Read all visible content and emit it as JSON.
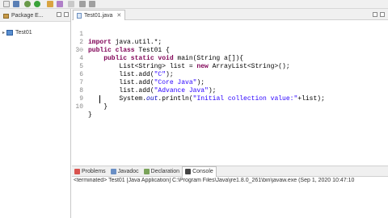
{
  "toolbar": {
    "icons": [
      "new-icon",
      "save-icon",
      "debug-icon",
      "run-icon",
      "search-icon",
      "refactor-icon",
      "navigate-icon",
      "back-icon",
      "forward-icon"
    ]
  },
  "package_explorer": {
    "tab_label": "Package E...",
    "tree": [
      {
        "label": "Test01"
      }
    ]
  },
  "editor": {
    "tab_label": "Test01.java",
    "lines": [
      {
        "num": "1",
        "code": "import java.util.*;"
      },
      {
        "num": "2",
        "code": "public class Test01 {"
      },
      {
        "num": "3⊖",
        "code": "    public static void main(String a[]){"
      },
      {
        "num": "4",
        "code": "        List<String> list = new ArrayList<String>();"
      },
      {
        "num": "5",
        "code": "        list.add(\"C\");"
      },
      {
        "num": "6",
        "code": "        list.add(\"Core Java\");"
      },
      {
        "num": "7",
        "code": "        list.add(\"Advance Java\");"
      },
      {
        "num": "8",
        "code": "        System.out.println(\"Initial collection value:\"+list);"
      },
      {
        "num": "9",
        "code": "    }"
      },
      {
        "num": "10",
        "code": "}"
      }
    ]
  },
  "bottom_panel": {
    "tabs": [
      {
        "label": "Problems",
        "icon": "problems-icon"
      },
      {
        "label": "Javadoc",
        "icon": "javadoc-icon"
      },
      {
        "label": "Declaration",
        "icon": "declaration-icon"
      },
      {
        "label": "Console",
        "icon": "console-icon",
        "active": true
      }
    ],
    "console_status": "<terminated> Test01 [Java Application] C:\\Program Files\\Java\\jre1.8.0_261\\bin\\javaw.exe  (Sep 1, 2020 10:47:10"
  }
}
